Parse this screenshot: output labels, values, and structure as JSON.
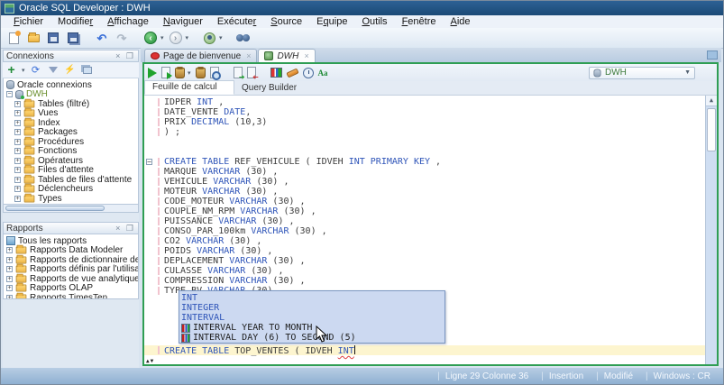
{
  "window": {
    "title": "Oracle SQL Developer : DWH"
  },
  "menu_bar": {
    "items": [
      {
        "label": "Fichier",
        "u": 0
      },
      {
        "label": "Modifier",
        "u": 7
      },
      {
        "label": "Affichage",
        "u": 0
      },
      {
        "label": "Naviguer",
        "u": 0
      },
      {
        "label": "Exécuter",
        "u": 7
      },
      {
        "label": "Source",
        "u": 0
      },
      {
        "label": "Equipe",
        "u": 1
      },
      {
        "label": "Outils",
        "u": 0
      },
      {
        "label": "Fenêtre",
        "u": 0
      },
      {
        "label": "Aide",
        "u": 0
      }
    ]
  },
  "main_toolbar": {
    "icons": [
      "new-file",
      "open-folder",
      "save",
      "save-all",
      "undo",
      "redo",
      "nav-back",
      "nav-forward",
      "team",
      "search"
    ]
  },
  "connections_panel": {
    "title": "Connexions",
    "toolbar_icons": [
      "add-connection",
      "refresh",
      "filter",
      "connection-status",
      "collapse-all"
    ],
    "root": "Oracle connexions",
    "connection": "DWH",
    "items": [
      "Tables (filtré)",
      "Vues",
      "Index",
      "Packages",
      "Procédures",
      "Fonctions",
      "Opérateurs",
      "Files d'attente",
      "Tables de files d'attente",
      "Déclencheurs",
      "Types"
    ]
  },
  "reports_panel": {
    "title": "Rapports",
    "root": "Tous les rapports",
    "items": [
      "Rapports Data Modeler",
      "Rapports de dictionnaire de données",
      "Rapports définis par l'utilisateur",
      "Rapports de vue analytique",
      "Rapports OLAP",
      "Rapports TimesTen"
    ]
  },
  "tabs": [
    {
      "label": "Page de bienvenue",
      "icon": "oracle-icon",
      "active": false
    },
    {
      "label": "DWH",
      "icon": "database-icon",
      "active": true
    }
  ],
  "worksheet": {
    "toolbar_icons": [
      "run-statement",
      "run-script",
      "explain-plan",
      "autotrace",
      "query-plan",
      "commit",
      "rollback",
      "monitor-sql",
      "clear",
      "sql-history",
      "change-case"
    ],
    "connection_selector": "DWH",
    "subtabs": [
      {
        "label": "Feuille de calcul",
        "active": true
      },
      {
        "label": "Query Builder",
        "active": false
      }
    ]
  },
  "editor": {
    "lines": [
      {
        "tokens": [
          [
            "IDPER ",
            "id"
          ],
          [
            "INT",
            "kw"
          ],
          [
            " ,",
            "id"
          ]
        ]
      },
      {
        "tokens": [
          [
            "DATE_VENTE ",
            "id"
          ],
          [
            "DATE",
            "kw"
          ],
          [
            ",",
            "id"
          ]
        ]
      },
      {
        "tokens": [
          [
            "PRIX ",
            "id"
          ],
          [
            "DECIMAL",
            "kw"
          ],
          [
            " (10,3)",
            "id"
          ]
        ]
      },
      {
        "tokens": [
          [
            ") ;",
            "id"
          ]
        ]
      },
      {
        "tokens": []
      },
      {
        "tokens": []
      },
      {
        "fold": true,
        "tokens": [
          [
            "CREATE TABLE",
            "kw"
          ],
          [
            " REF_VEHICULE ( IDVEH ",
            "id"
          ],
          [
            "INT PRIMARY KEY",
            "kw"
          ],
          [
            " ,",
            "id"
          ]
        ]
      },
      {
        "tokens": [
          [
            "MARQUE ",
            "id"
          ],
          [
            "VARCHAR",
            "kw"
          ],
          [
            " (30) ,",
            "id"
          ]
        ]
      },
      {
        "tokens": [
          [
            "VEHICULE ",
            "id"
          ],
          [
            "VARCHAR",
            "kw"
          ],
          [
            " (30) ,",
            "id"
          ]
        ]
      },
      {
        "tokens": [
          [
            "MOTEUR ",
            "id"
          ],
          [
            "VARCHAR",
            "kw"
          ],
          [
            " (30) ,",
            "id"
          ]
        ]
      },
      {
        "tokens": [
          [
            "CODE_MOTEUR ",
            "id"
          ],
          [
            "VARCHAR",
            "kw"
          ],
          [
            " (30) ,",
            "id"
          ]
        ]
      },
      {
        "tokens": [
          [
            "COUPLE_NM_RPM ",
            "id"
          ],
          [
            "VARCHAR",
            "kw"
          ],
          [
            " (30) ,",
            "id"
          ]
        ]
      },
      {
        "tokens": [
          [
            "PUISSANCE ",
            "id"
          ],
          [
            "VARCHAR",
            "kw"
          ],
          [
            " (30) ,",
            "id"
          ]
        ]
      },
      {
        "tokens": [
          [
            "CONSO_PAR_100km ",
            "id"
          ],
          [
            "VARCHAR",
            "kw"
          ],
          [
            " (30) ,",
            "id"
          ]
        ]
      },
      {
        "tokens": [
          [
            "CO2 ",
            "id"
          ],
          [
            "VARCHAR",
            "kw"
          ],
          [
            " (30) ,",
            "id"
          ]
        ]
      },
      {
        "tokens": [
          [
            "POIDS ",
            "id"
          ],
          [
            "VARCHAR",
            "kw"
          ],
          [
            " (30) ,",
            "id"
          ]
        ]
      },
      {
        "tokens": [
          [
            "DEPLACEMENT ",
            "id"
          ],
          [
            "VARCHAR",
            "kw"
          ],
          [
            " (30) ,",
            "id"
          ]
        ]
      },
      {
        "tokens": [
          [
            "CULASSE ",
            "id"
          ],
          [
            "VARCHAR",
            "kw"
          ],
          [
            " (30) ,",
            "id"
          ]
        ]
      },
      {
        "tokens": [
          [
            "COMPRESSION ",
            "id"
          ],
          [
            "VARCHAR",
            "kw"
          ],
          [
            " (30) ,",
            "id"
          ]
        ]
      },
      {
        "tokens": [
          [
            "TYPE_BV ",
            "id"
          ],
          [
            "VARCHAR",
            "kw"
          ],
          [
            " (30) ,",
            "id"
          ]
        ]
      },
      {
        "tokens": []
      },
      {
        "tokens": []
      },
      {
        "tokens": []
      },
      {
        "tokens": []
      },
      {
        "tokens": []
      },
      {
        "current": true,
        "caret": true,
        "tokens": [
          [
            "CREATE TABLE",
            "kw"
          ],
          [
            " TOP_VENTES ( IDVEH ",
            "id"
          ],
          [
            "INT",
            "kw-err"
          ]
        ]
      },
      {
        "tokens": []
      }
    ],
    "popup": {
      "items": [
        {
          "label": "INT",
          "kind": "kw"
        },
        {
          "label": "INTEGER",
          "kind": "kw"
        },
        {
          "label": "INTERVAL",
          "kind": "kw"
        },
        {
          "label": "INTERVAL YEAR TO MONTH",
          "kind": "col"
        },
        {
          "label": "INTERVAL DAY (6) TO SECOND (5)",
          "kind": "col"
        }
      ]
    }
  },
  "status_bar": {
    "segments": [
      "Ligne 29 Colonne 36",
      "Insertion",
      "Modifié",
      "Windows : CR"
    ]
  }
}
